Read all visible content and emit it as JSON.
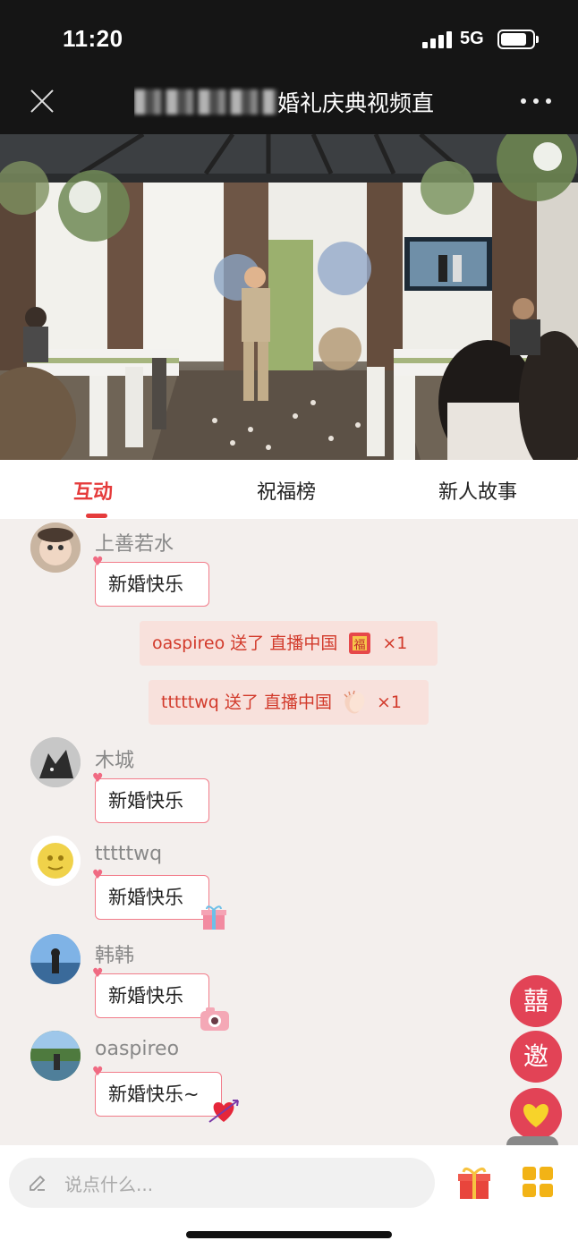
{
  "status_bar": {
    "time": "11:20",
    "network": "5G"
  },
  "nav": {
    "title": "婚礼庆典视频直"
  },
  "tabs": [
    {
      "label": "互动",
      "active": true
    },
    {
      "label": "祝福榜",
      "active": false
    },
    {
      "label": "新人故事",
      "active": false
    }
  ],
  "messages": [
    {
      "type": "chat",
      "user": "上善若水",
      "text": "新婚快乐",
      "sticker": null
    },
    {
      "type": "gift",
      "user": "oaspireo",
      "action": "送了",
      "gift": "直播中国",
      "gift_icon": "fu-card-icon",
      "count": "×1"
    },
    {
      "type": "gift",
      "user": "tttttwq",
      "action": "送了",
      "gift": "直播中国",
      "gift_icon": "clap-icon",
      "count": "×1"
    },
    {
      "type": "chat",
      "user": "木城",
      "text": "新婚快乐",
      "sticker": null
    },
    {
      "type": "chat",
      "user": "tttttwq",
      "text": "新婚快乐",
      "sticker": "gift-box-icon"
    },
    {
      "type": "chat",
      "user": "韩韩",
      "text": "新婚快乐",
      "sticker": "camera-icon"
    },
    {
      "type": "chat",
      "user": "oaspireo",
      "text": "新婚快乐~",
      "sticker": "heart-arrow-icon"
    }
  ],
  "side_buttons": [
    {
      "label": "囍",
      "name": "double-happiness-button"
    },
    {
      "label": "邀",
      "name": "invite-button"
    },
    {
      "label": "",
      "name": "like-heart-button",
      "icon": "yellow-heart-icon"
    }
  ],
  "input": {
    "placeholder": "说点什么..."
  },
  "colors": {
    "accent": "#e53b3b",
    "bubble_border": "#f27c8a",
    "gift_bg": "#f8e1dc",
    "fab": "#e24356"
  }
}
